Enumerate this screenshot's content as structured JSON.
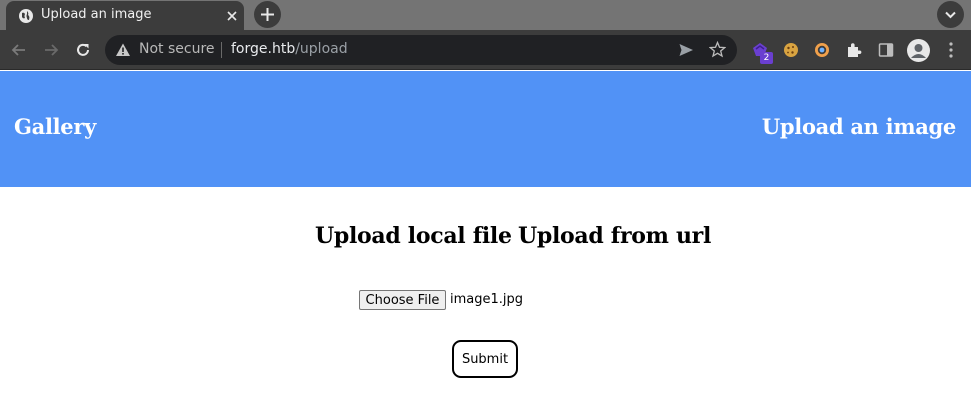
{
  "browser": {
    "tab": {
      "title": "Upload an image"
    },
    "toolbar": {
      "security_label": "Not secure",
      "url_host": "forge.htb",
      "url_path": "/upload"
    },
    "extensions": {
      "badge_count": "2"
    }
  },
  "page": {
    "header": {
      "gallery_link": "Gallery",
      "upload_link": "Upload an image",
      "background_color": "#5192f6"
    },
    "modes": {
      "local_label": "Upload local file",
      "url_label": "Upload from url"
    },
    "form": {
      "choose_file_label": "Choose File",
      "selected_file": "image1.jpg",
      "submit_label": "Submit"
    }
  }
}
